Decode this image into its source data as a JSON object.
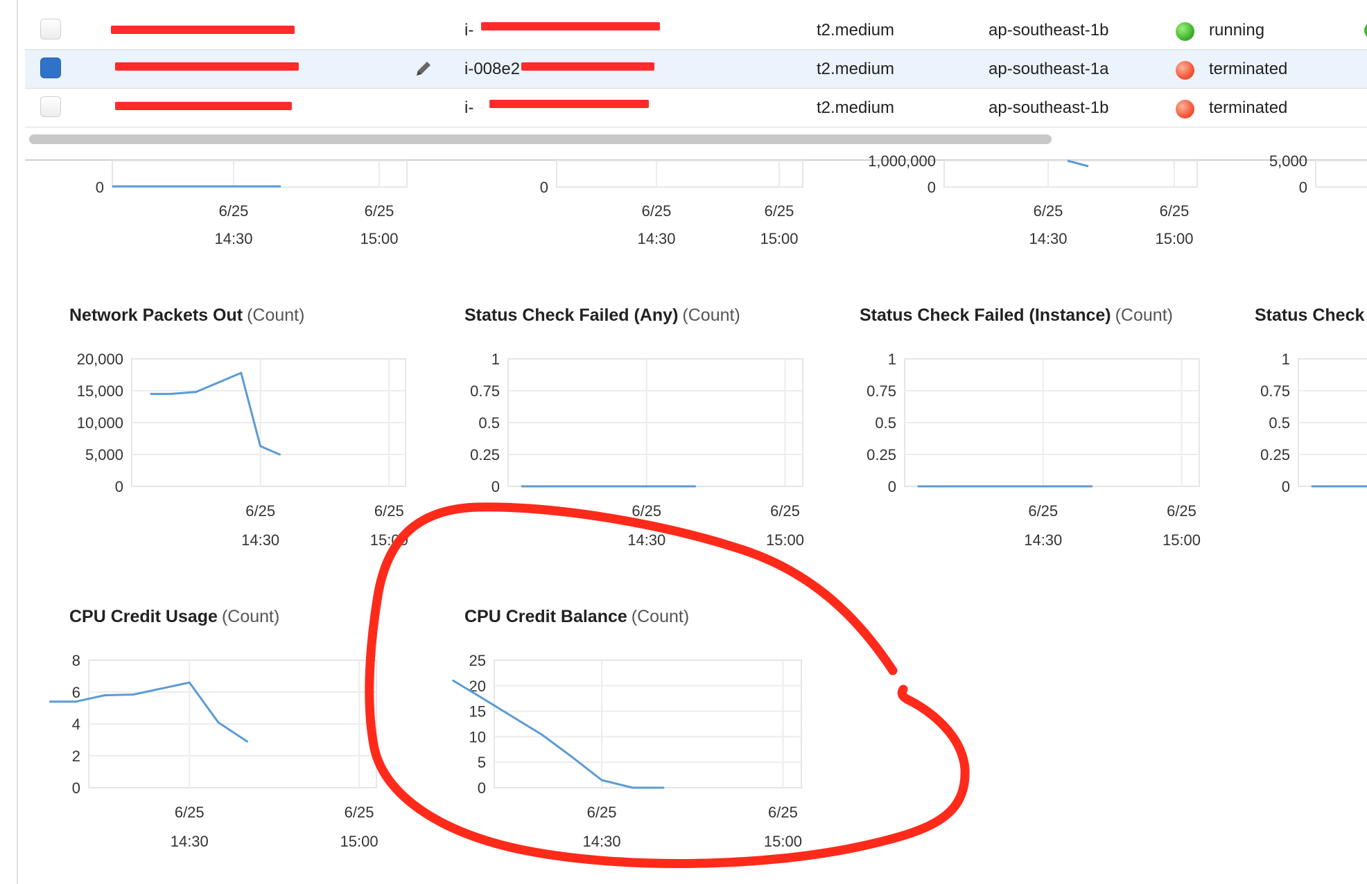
{
  "table": {
    "rows": [
      {
        "name": "",
        "id_prefix": "i-",
        "type": "t2.medium",
        "az": "ap-southeast-1b",
        "state": "running",
        "state_color": "#3fb52b",
        "selected": false,
        "status_ok": true
      },
      {
        "name": "",
        "id_prefix": "i-008e2",
        "type": "t2.medium",
        "az": "ap-southeast-1a",
        "state": "terminated",
        "state_color": "#f4583a",
        "selected": true,
        "status_ok": false
      },
      {
        "name": "",
        "id_prefix": "i-",
        "type": "t2.medium",
        "az": "ap-southeast-1b",
        "state": "terminated",
        "state_color": "#f4583a",
        "selected": false,
        "status_ok": false
      }
    ],
    "icons": {
      "edit": "pencil-icon",
      "status": "check-circle-icon"
    }
  },
  "top_charts": [
    {
      "y_tick": "0",
      "x_ticks": [
        {
          "date": "6/25",
          "time": "14:30"
        },
        {
          "date": "6/25",
          "time": "15:00"
        }
      ],
      "cut_tick": ""
    },
    {
      "y_tick": "0",
      "x_ticks": [
        {
          "date": "6/25",
          "time": "14:30"
        },
        {
          "date": "6/25",
          "time": "15:00"
        }
      ],
      "cut_tick": ""
    },
    {
      "y_tick": "0",
      "x_ticks": [
        {
          "date": "6/25",
          "time": "14:30"
        },
        {
          "date": "6/25",
          "time": "15:00"
        }
      ],
      "cut_tick": "1,000,000"
    },
    {
      "y_tick": "0",
      "x_ticks": [],
      "cut_tick": "5,000"
    }
  ],
  "chart_data": [
    {
      "type": "line",
      "title": "Network Packets Out",
      "unit": "(Count)",
      "y_ticks": [
        "20,000",
        "15,000",
        "10,000",
        "5,000",
        "0"
      ],
      "ylim": [
        0,
        20000
      ],
      "x_ticks": [
        {
          "date": "6/25",
          "time": "14:30"
        },
        {
          "date": "6/25",
          "time": "15:00"
        }
      ],
      "grid": true,
      "series": [
        {
          "values": [
            [
              -0.85,
              14500
            ],
            [
              -0.7,
              14500
            ],
            [
              -0.5,
              14800
            ],
            [
              -0.15,
              17800
            ],
            [
              0,
              6300
            ],
            [
              0.15,
              5000
            ]
          ]
        }
      ]
    },
    {
      "type": "line",
      "title": "Status Check Failed (Any)",
      "unit": "(Count)",
      "y_ticks": [
        "1",
        "0.75",
        "0.5",
        "0.25",
        "0"
      ],
      "ylim": [
        0,
        1
      ],
      "x_ticks": [
        {
          "date": "6/25",
          "time": "14:30"
        },
        {
          "date": "6/25",
          "time": "15:00"
        }
      ],
      "grid": true,
      "series": [
        {
          "values": [
            [
              -0.9,
              0
            ],
            [
              0.35,
              0
            ]
          ]
        }
      ]
    },
    {
      "type": "line",
      "title": "Status Check Failed (Instance)",
      "unit": "(Count)",
      "y_ticks": [
        "1",
        "0.75",
        "0.5",
        "0.25",
        "0"
      ],
      "ylim": [
        0,
        1
      ],
      "x_ticks": [
        {
          "date": "6/25",
          "time": "14:30"
        },
        {
          "date": "6/25",
          "time": "15:00"
        }
      ],
      "grid": true,
      "series": [
        {
          "values": [
            [
              -0.9,
              0
            ],
            [
              0.35,
              0
            ]
          ]
        }
      ]
    },
    {
      "type": "line",
      "title": "Status Check",
      "unit": "",
      "y_ticks": [
        "1",
        "0.75",
        "0.5",
        "0.25",
        "0"
      ],
      "ylim": [
        0,
        1
      ],
      "x_ticks": [],
      "grid": true,
      "series": [
        {
          "values": [
            [
              -0.9,
              0
            ],
            [
              0.0,
              0
            ]
          ]
        }
      ]
    },
    {
      "type": "line",
      "title": "CPU Credit Usage",
      "unit": "(Count)",
      "y_ticks": [
        "8",
        "6",
        "4",
        "2",
        "0"
      ],
      "ylim": [
        0,
        8
      ],
      "x_ticks": [
        {
          "date": "6/25",
          "time": "14:30"
        },
        {
          "date": "6/25",
          "time": "15:00"
        }
      ],
      "grid": true,
      "series": [
        {
          "values": [
            [
              -0.82,
              5.4
            ],
            [
              -0.67,
              5.4
            ],
            [
              -0.5,
              5.8
            ],
            [
              -0.33,
              5.85
            ],
            [
              0,
              6.6
            ],
            [
              0.17,
              4.1
            ],
            [
              0.34,
              2.9
            ]
          ]
        }
      ]
    },
    {
      "type": "line",
      "title": "CPU Credit Balance",
      "unit": "(Count)",
      "y_ticks": [
        "25",
        "20",
        "15",
        "10",
        "5",
        "0"
      ],
      "ylim": [
        0,
        25
      ],
      "x_ticks": [
        {
          "date": "6/25",
          "time": "14:30"
        },
        {
          "date": "6/25",
          "time": "15:00"
        }
      ],
      "grid": true,
      "series": [
        {
          "values": [
            [
              -0.82,
              21
            ],
            [
              -0.67,
              17.8
            ],
            [
              -0.33,
              10.4
            ],
            [
              -0.17,
              6.2
            ],
            [
              0,
              1.5
            ],
            [
              0.17,
              0
            ],
            [
              0.34,
              0
            ]
          ]
        }
      ]
    }
  ],
  "annotation": {
    "color": "#ff2a1a",
    "shape": "hand-drawn-circle"
  }
}
